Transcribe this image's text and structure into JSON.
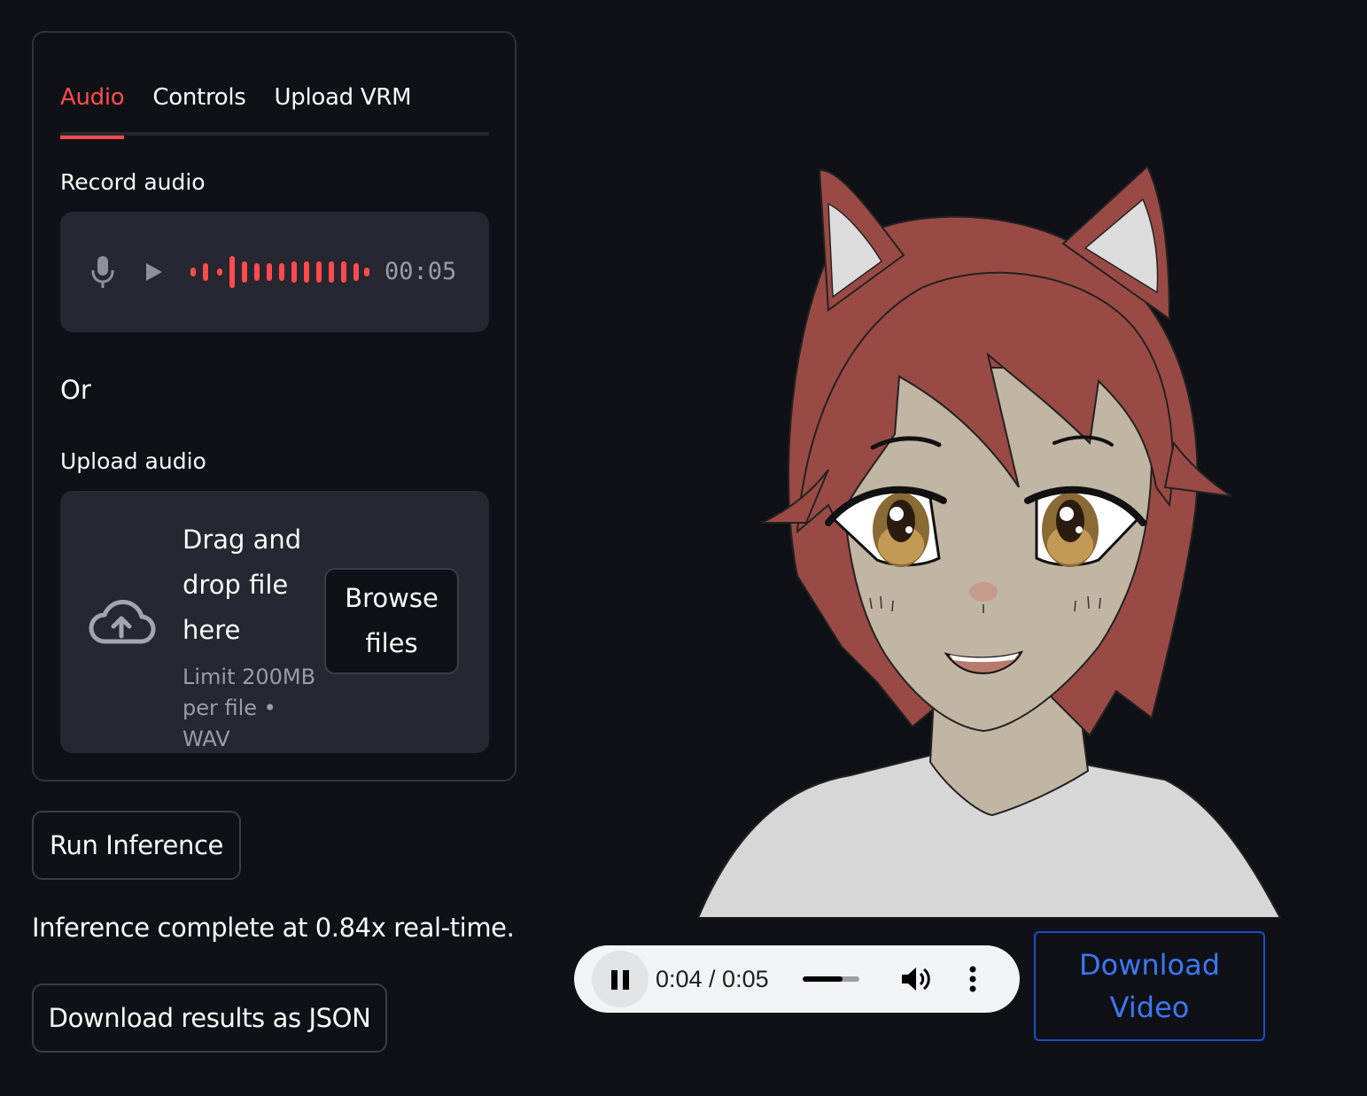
{
  "tabs": [
    {
      "label": "Audio",
      "active": true
    },
    {
      "label": "Controls",
      "active": false
    },
    {
      "label": "Upload VRM",
      "active": false
    }
  ],
  "record": {
    "label": "Record audio",
    "time": "00:05",
    "mic_icon": "microphone-icon",
    "play_icon": "play-icon",
    "waveform_color": "#ff4b4b"
  },
  "or_label": "Or",
  "upload": {
    "label": "Upload audio",
    "drag_text": "Drag and drop file here",
    "limit_text": "Limit 200MB per file • WAV",
    "browse_label": "Browse files",
    "cloud_icon": "cloud-upload-icon"
  },
  "run_button": "Run Inference",
  "status_text": "Inference complete at 0.84x real-time.",
  "download_json_button": "Download results as JSON",
  "player": {
    "time": "0:04 / 0:05",
    "volume_level": 0.7,
    "pause_icon": "pause-icon",
    "volume_icon": "volume-icon",
    "more_icon": "more-vert-icon"
  },
  "download_video_button": "Download Video",
  "colors": {
    "background": "#0f1117",
    "accent": "#ff4b4b",
    "panel": "#262730",
    "link_blue": "#3b78f2",
    "hair": "#9a4a45",
    "skin": "#c1b5a3",
    "shirt": "#d7d7d7"
  }
}
